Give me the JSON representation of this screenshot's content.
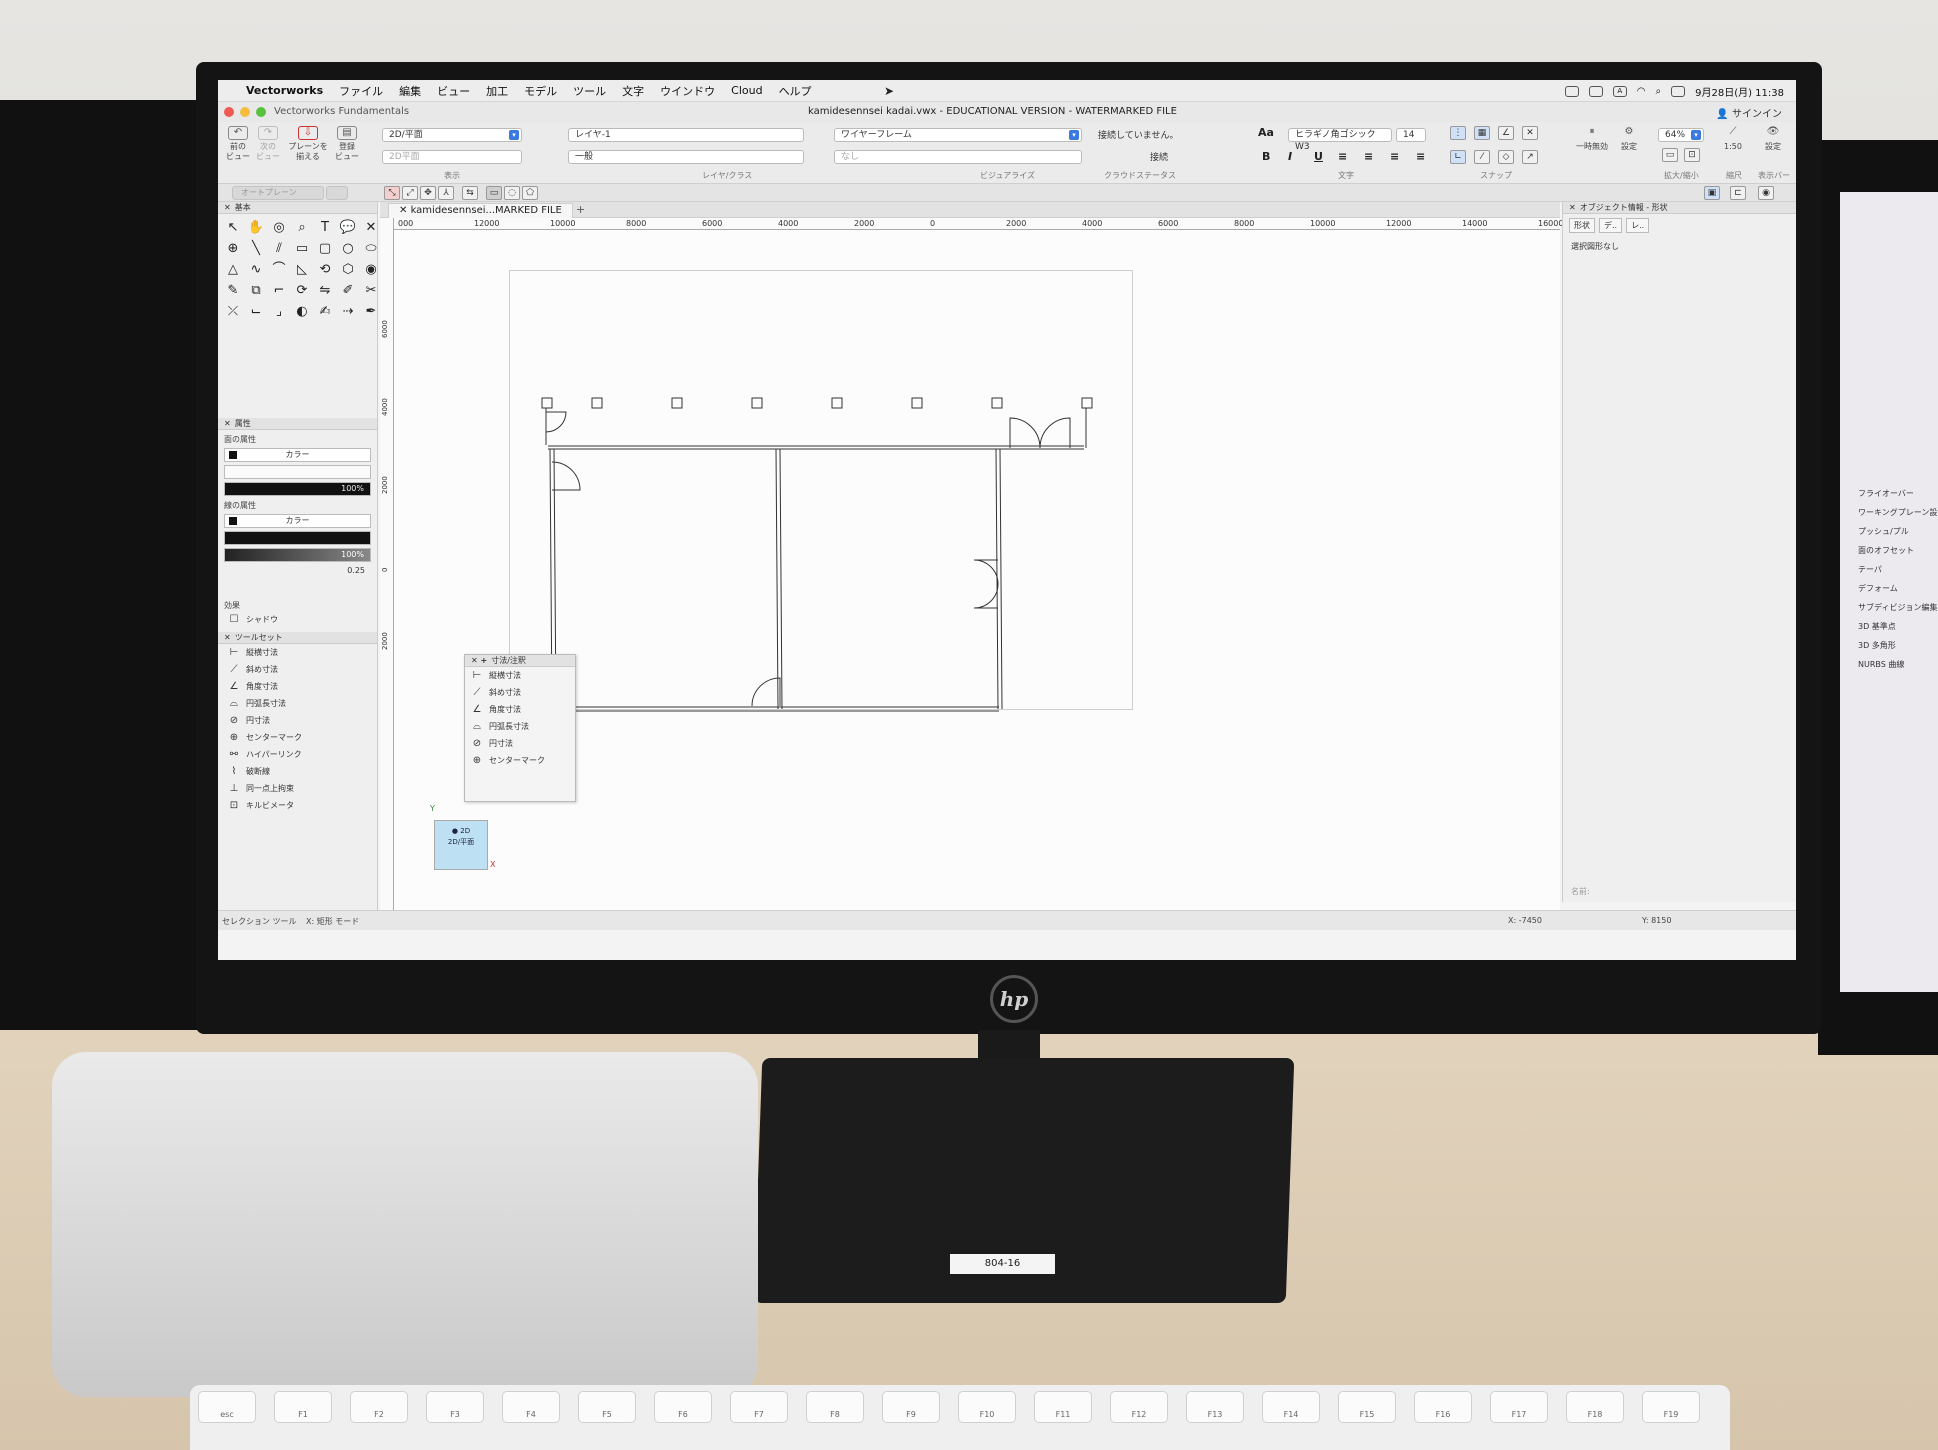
{
  "menubar": {
    "items": [
      "Vectorworks",
      "ファイル",
      "編集",
      "ビュー",
      "加工",
      "モデル",
      "ツール",
      "文字",
      "ウインドウ",
      "Cloud",
      "ヘルプ"
    ],
    "clock": "9月28日(月) 11:38"
  },
  "window": {
    "app_name": "Vectorworks Fundamentals",
    "title": "kamidesennsei kadai.vwx - EDUCATIONAL VERSION - WATERMARKED FILE",
    "signin": "サインイン"
  },
  "toolbar": {
    "prev_view": "前の\nビュー",
    "next_view": "次の\nビュー",
    "plane_align": "プレーンを\n揃える",
    "saved_view": "登録\nビュー",
    "view_select": "2D/平面",
    "view_select2": "2D平面",
    "layer_select": "レイヤ-1",
    "class_select": "一般",
    "render_select": "ワイヤーフレーム",
    "render_select2": "なし",
    "cloud_status": "接続していません。",
    "cloud_sub": "接続",
    "font_name": "ヒラギノ角ゴシック W3",
    "font_size": "14",
    "pause": "一時無効",
    "settings": "設定",
    "zoom": "64%",
    "scale": "1:50",
    "scale_label": "縮尺",
    "display_settings": "設定",
    "group_labels": {
      "view": "表示",
      "layer_class": "レイヤ/クラス",
      "visualize": "ビジュアライズ",
      "cloud": "クラウドステータス",
      "text": "文字",
      "snap": "スナップ",
      "zoom": "拡大/縮小",
      "display_bar": "表示バー"
    }
  },
  "bar2": {
    "auto_plane": "オートプレーン"
  },
  "palettes": {
    "basic": "基本",
    "attributes": "属性",
    "fill_attr": "面の属性",
    "color": "カラー",
    "opacity1": "100%",
    "line_attr": "線の属性",
    "opacity2": "100%",
    "thickness": "0.25",
    "effects": "効果",
    "shadow": "シャドウ",
    "toolset": "ツールセット",
    "toolset_items": [
      "縦横寸法",
      "斜め寸法",
      "角度寸法",
      "円弧長寸法",
      "円寸法",
      "センターマーク",
      "ハイパーリンク",
      "破断線",
      "同一点上拘束",
      "キルビメータ"
    ]
  },
  "float_palette": {
    "title": "寸法/注釈",
    "items": [
      "縦横寸法",
      "斜め寸法",
      "角度寸法",
      "円弧長寸法",
      "円寸法",
      "センターマーク"
    ]
  },
  "document_tab": "kamidesennsei...MARKED FILE",
  "ruler": {
    "ticks": [
      "000",
      "12000",
      "10000",
      "8000",
      "6000",
      "4000",
      "2000",
      "0",
      "2000",
      "4000",
      "6000",
      "8000",
      "10000",
      "12000",
      "14000",
      "16000"
    ],
    "vticks": [
      "6000",
      "4000",
      "2000",
      "0",
      "2000"
    ]
  },
  "view_indicator": {
    "mode": "2D",
    "plane": "2D/平面",
    "axis_x": "X",
    "axis_y": "Y"
  },
  "right_panel": {
    "title": "オブジェクト情報 - 形状",
    "tab_shape": "形状",
    "tab_data": "デ..",
    "tab_render": "レ..",
    "no_selection": "選択図形なし",
    "name_label": "名前:"
  },
  "statusbar": {
    "tool": "セレクション ツール",
    "mode": "X: 矩形 モード",
    "x": "X: -7450",
    "y": "Y: 8150"
  },
  "hardware": {
    "brand": "hp",
    "asset_label": "804-16",
    "keys": [
      "esc",
      "F1",
      "F2",
      "F3",
      "F4",
      "F5",
      "F6",
      "F7",
      "F8",
      "F9",
      "F10",
      "F11",
      "F12",
      "F13",
      "F14",
      "F15",
      "F16",
      "F17",
      "F18",
      "F19"
    ]
  },
  "side_monitor": {
    "tools": [
      "フライオーバー",
      "ワーキングプレーン設",
      "プッシュ/プル",
      "面のオフセット",
      "テーパ",
      "デフォーム",
      "サブディビジョン編集",
      "3D 基準点",
      "3D 多角形",
      "NURBS 曲線"
    ]
  }
}
